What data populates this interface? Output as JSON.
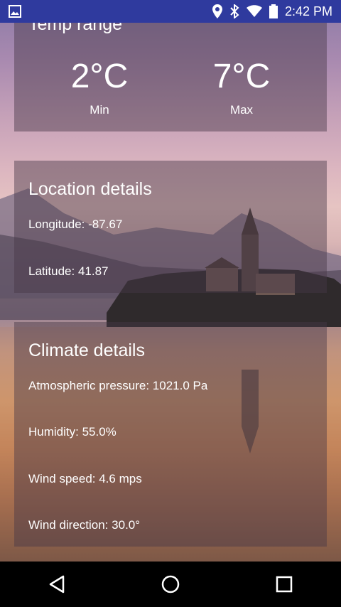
{
  "status_bar": {
    "time": "2:42 PM",
    "icons": [
      "image-icon",
      "location-icon",
      "bluetooth-icon",
      "wifi-icon",
      "battery-icon"
    ],
    "color": "#2f3a9e"
  },
  "temp_range": {
    "title": "Temp range",
    "min_value": "2°C",
    "min_label": "Min",
    "max_value": "7°C",
    "max_label": "Max"
  },
  "location_details": {
    "title": "Location details",
    "longitude": "Longitude: -87.67",
    "latitude": "Latitude: 41.87"
  },
  "climate_details": {
    "title": "Climate details",
    "pressure": "Atmospheric pressure: 1021.0 Pa",
    "humidity": "Humidity: 55.0%",
    "wind_speed": "Wind speed: 4.6 mps",
    "wind_direction": "Wind direction: 30.0°"
  },
  "nav_bar": {
    "buttons": [
      "back-icon",
      "home-icon",
      "recents-icon"
    ]
  }
}
